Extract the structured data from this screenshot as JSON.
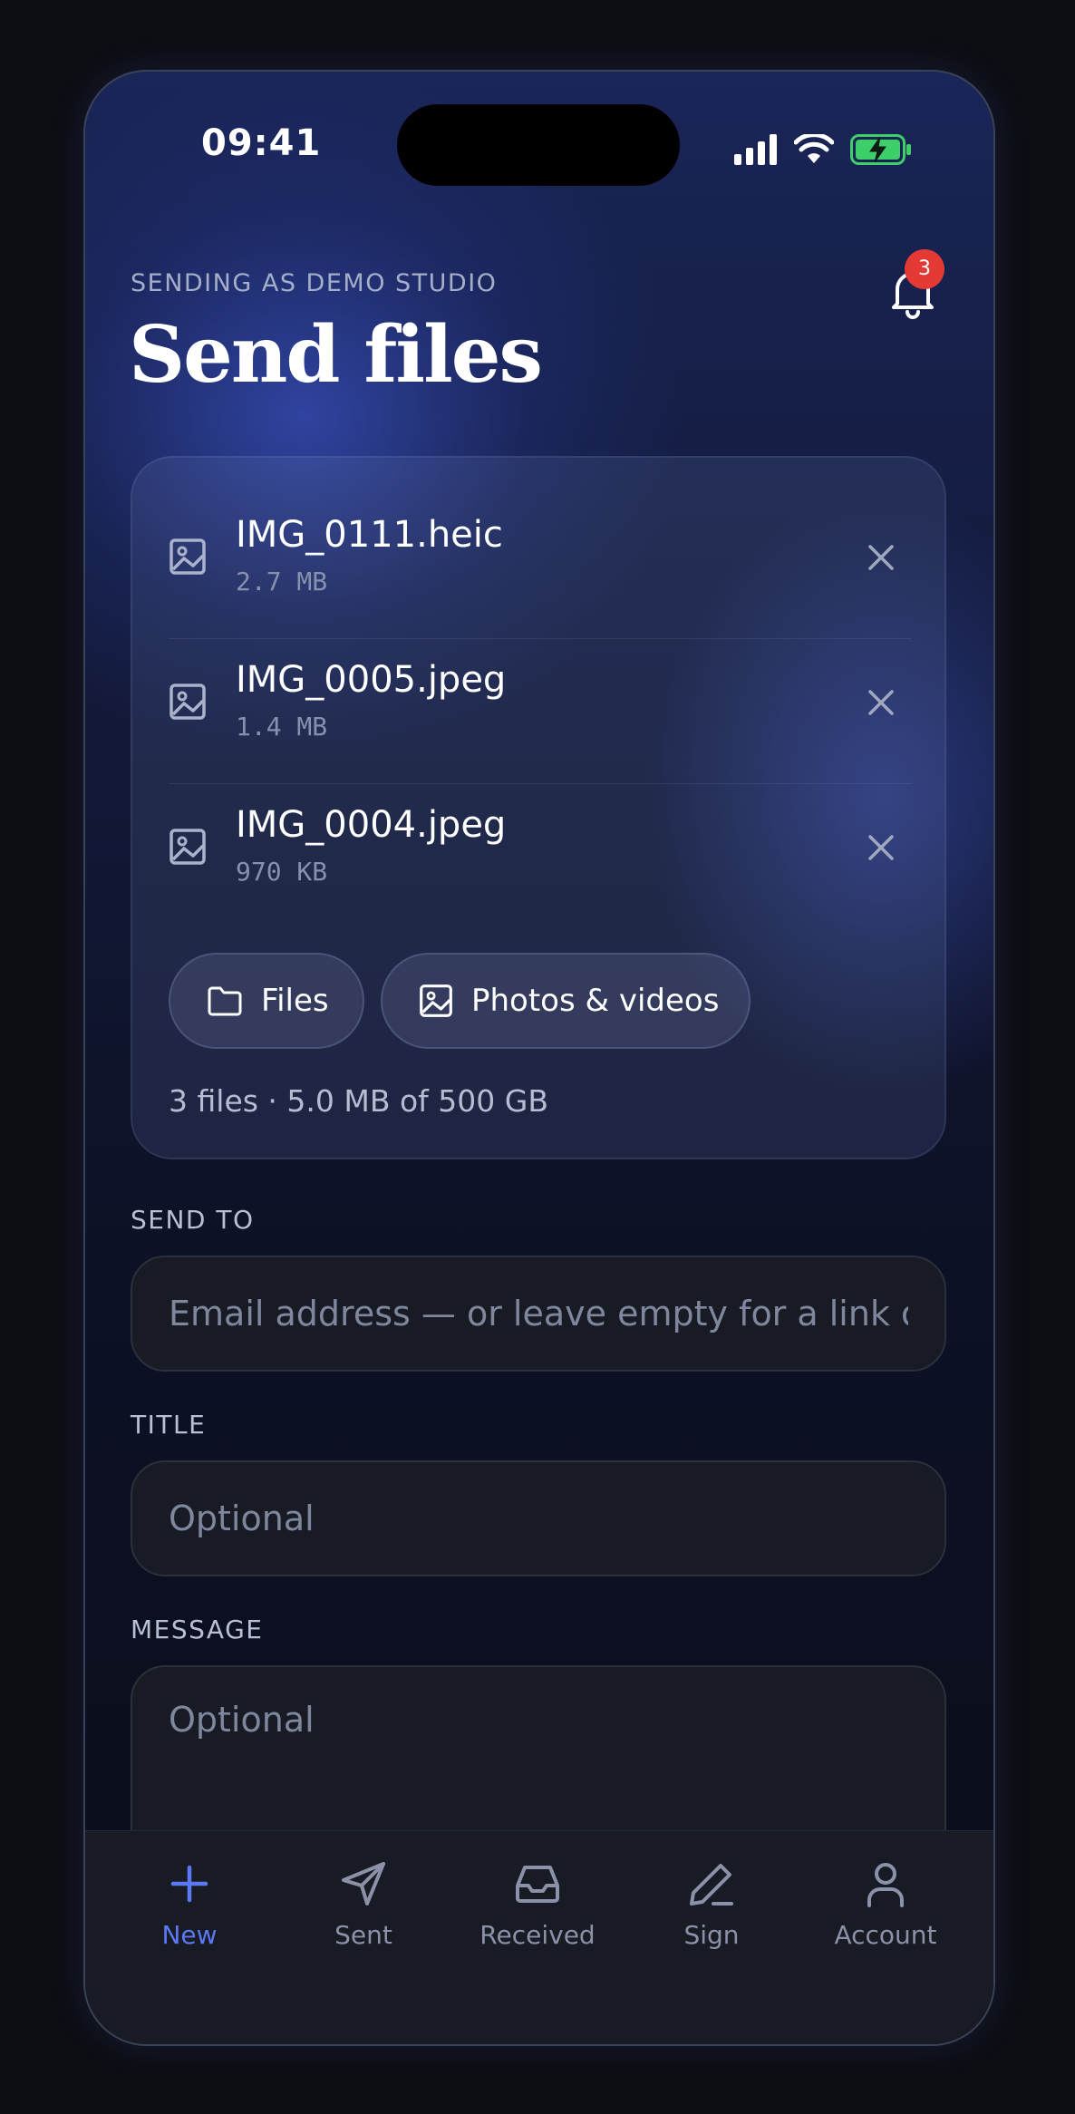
{
  "status_bar": {
    "time": "09:41"
  },
  "header": {
    "eyebrow": "SENDING AS DEMO STUDIO",
    "title": "Send files",
    "notifications_count": "3"
  },
  "files": [
    {
      "name": "IMG_0111.heic",
      "size": "2.7 MB"
    },
    {
      "name": "IMG_0005.jpeg",
      "size": "1.4 MB"
    },
    {
      "name": "IMG_0004.jpeg",
      "size": "970 KB"
    }
  ],
  "actions": {
    "files_label": "Files",
    "photos_label": "Photos & videos"
  },
  "summary": "3 files · 5.0 MB of 500 GB",
  "form": {
    "send_to": {
      "label": "SEND TO",
      "placeholder": "Email address — or leave empty for a link only",
      "value": ""
    },
    "title": {
      "label": "TITLE",
      "placeholder": "Optional",
      "value": ""
    },
    "message": {
      "label": "MESSAGE",
      "placeholder": "Optional",
      "value": ""
    }
  },
  "tabs": [
    {
      "label": "New",
      "icon": "plus-icon",
      "active": true
    },
    {
      "label": "Sent",
      "icon": "send-icon",
      "active": false
    },
    {
      "label": "Received",
      "icon": "inbox-icon",
      "active": false
    },
    {
      "label": "Sign",
      "icon": "pen-icon",
      "active": false
    },
    {
      "label": "Account",
      "icon": "user-icon",
      "active": false
    }
  ],
  "colors": {
    "accent": "#5b78f5",
    "badge": "#e53935",
    "battery": "#3ecf6a"
  }
}
